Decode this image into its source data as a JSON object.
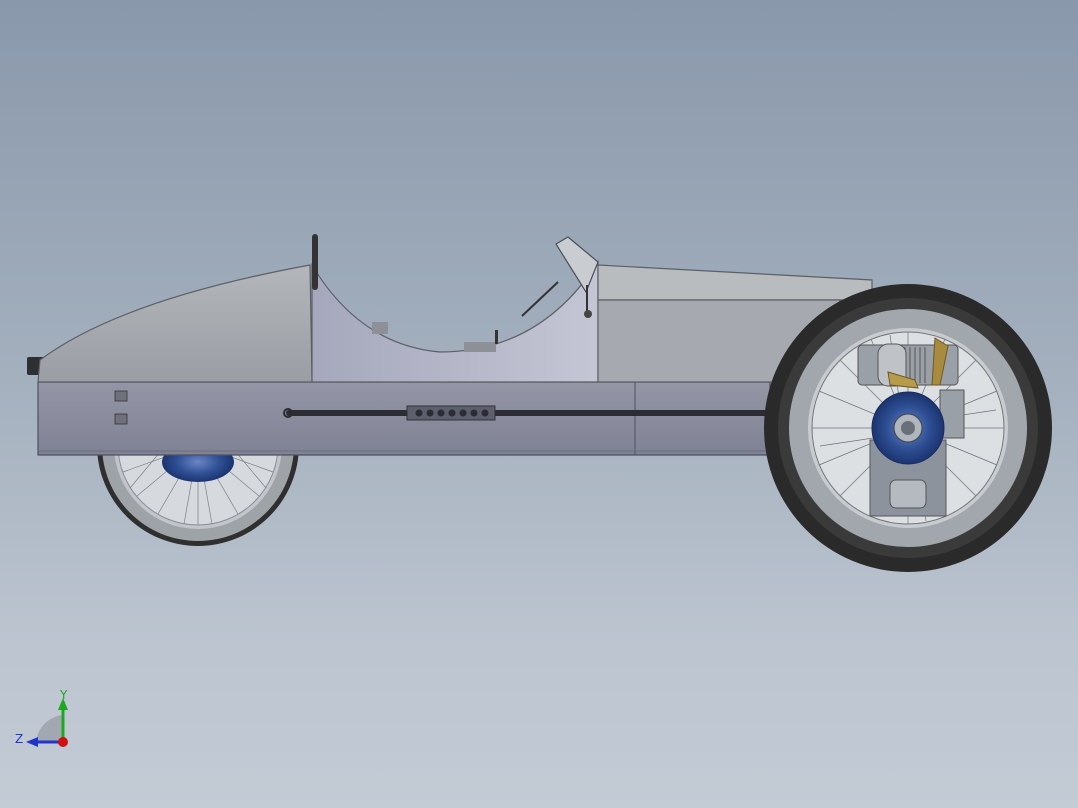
{
  "view_triad": {
    "y_label": "Y",
    "z_label": "Z",
    "colors": {
      "x_axis": "#d01010",
      "y_axis": "#1fa81f",
      "z_axis": "#2233cc"
    }
  },
  "scene": {
    "model": "three-wheeler",
    "background_colors": [
      "#8998ab",
      "#c3cbd5"
    ],
    "body_color": "#a9adb3",
    "hub_color": "#2e4f94",
    "tire_color": "#2b2b2b"
  }
}
